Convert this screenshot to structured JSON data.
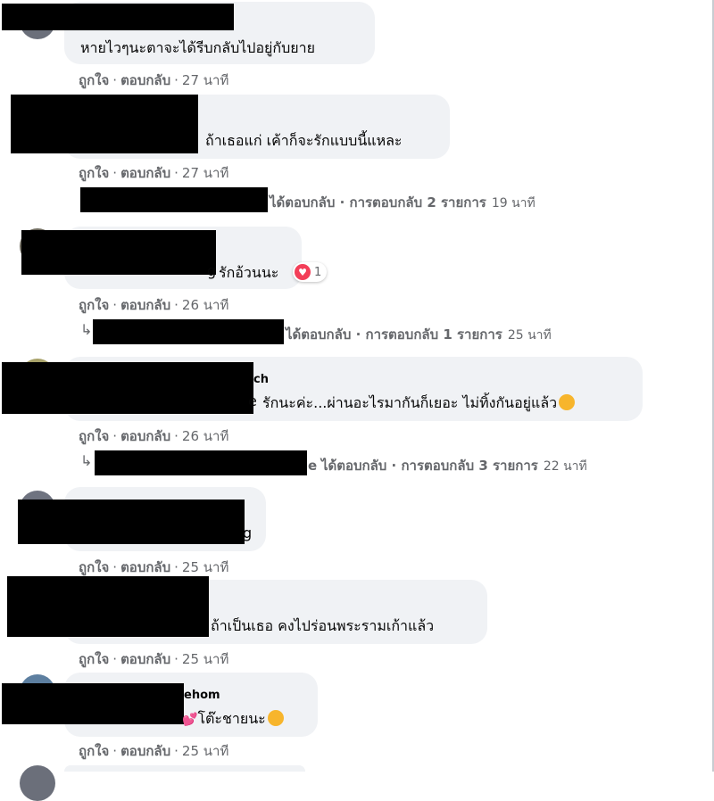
{
  "actions": {
    "like": "ถูกใจ",
    "reply": "ตอบกลับ",
    "sep": "·"
  },
  "comments": [
    {
      "text": "หายไวๆนะตาจะได้รีบกลับไปอยู่กับยาย",
      "time": "27 นาที"
    },
    {
      "text": "ถ้าเธอแก่ เค้าก็จะรักแบบนี้แหละ",
      "time": "27 นาที",
      "replies": {
        "text": "ได้ตอบกลับ · การตอบกลับ 2 รายการ",
        "time": "19 นาที"
      }
    },
    {
      "text": "รักอ้วนนะ",
      "name_fragment": "g",
      "time": "26 นาที",
      "reaction_count": "1",
      "reaction_icon": "love-icon",
      "replies": {
        "text": "ได้ตอบกลับ · การตอบกลับ 1 รายการ",
        "time": "25 นาที"
      }
    },
    {
      "name_fragment": "ch",
      "text_fragment": "e",
      "text": "รักนะค่ะ...ผ่านอะไรมากันก็เยอะ ไม่ทิ้งกันอยู่แล้ว",
      "emoji": "smiling-face-with-hearts",
      "time": "26 นาที",
      "replies": {
        "name_fragment": "e",
        "text": "ได้ตอบกลับ · การตอบกลับ 3 รายการ",
        "time": "22 นาที"
      }
    },
    {
      "text_fragment": "g",
      "time": "25 นาที"
    },
    {
      "text": "ถ้าเป็นเธอ คงไปร่อนพระรามเก้าแล้ว",
      "time": "25 นาที"
    },
    {
      "name_fragment": "ehom",
      "text": "โต๊ะชายนะ",
      "hearts": "💕",
      "emoji": "smiling-face",
      "time": "25 นาที"
    }
  ],
  "colors": {
    "bubble": "#f0f2f5",
    "meta": "#65676b",
    "text": "#050505",
    "love": "#f33e58"
  }
}
